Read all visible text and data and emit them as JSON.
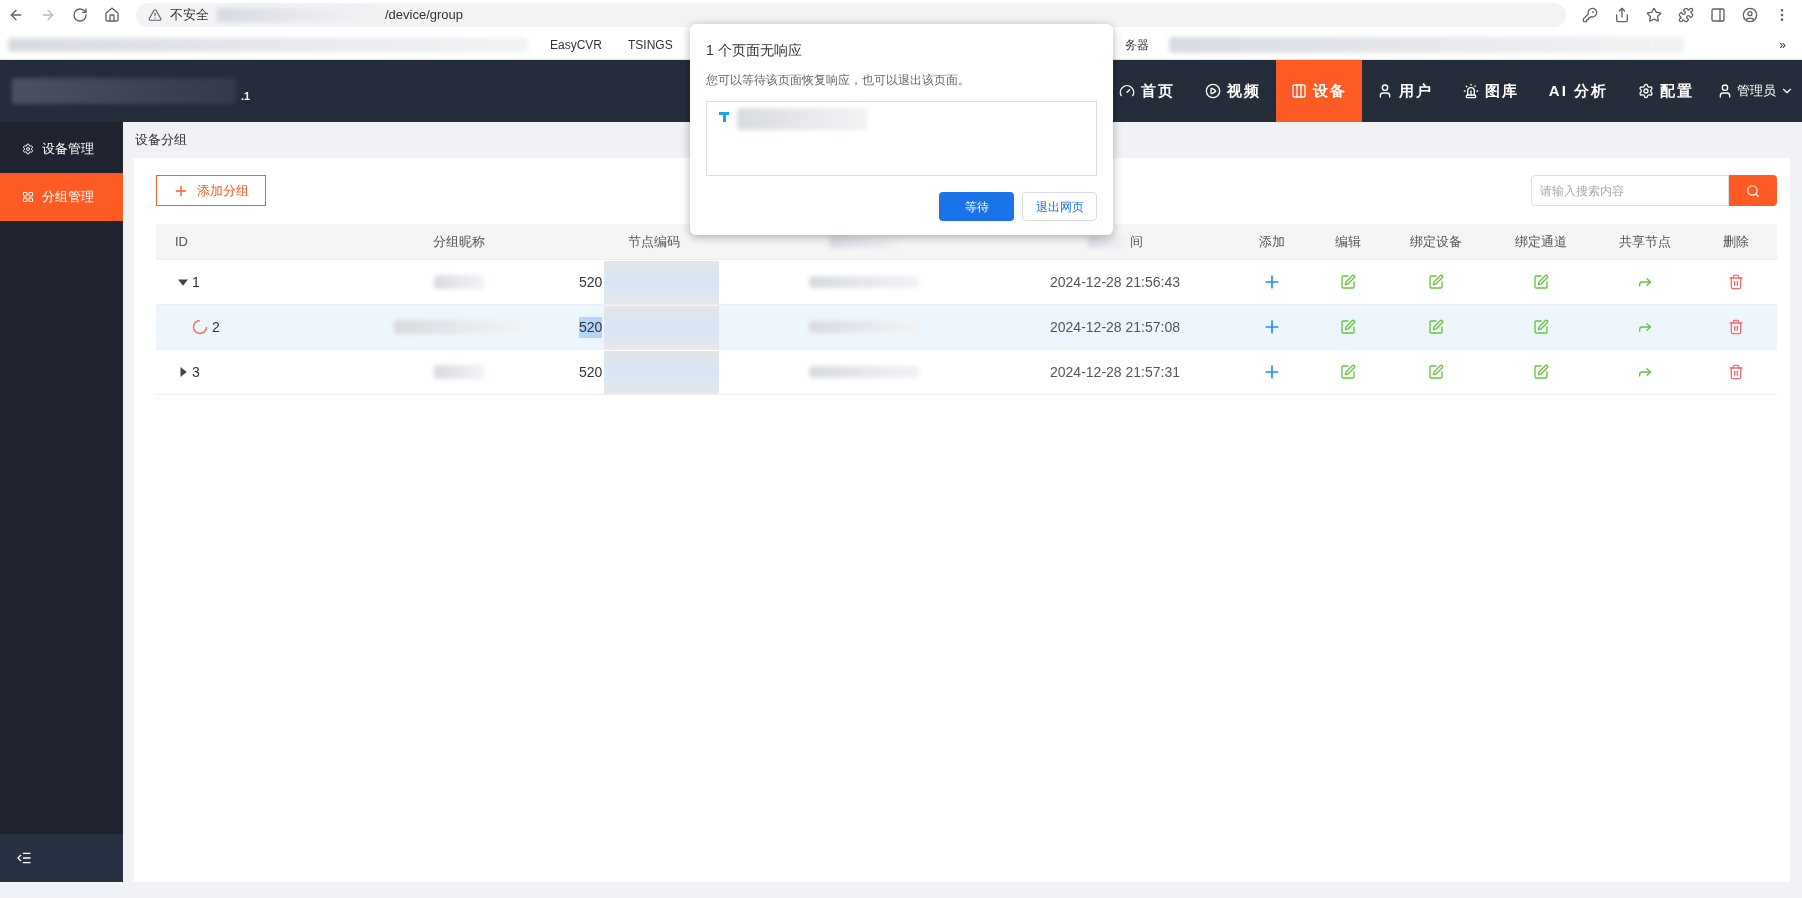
{
  "browser": {
    "security": "不安全",
    "url": "/device/group",
    "bookmarks": [
      {
        "label": "EasyCVR"
      },
      {
        "label": "TSINGS"
      }
    ],
    "bookmark_after_dialog": "务器",
    "more": "»"
  },
  "header": {
    "title_suffix": ".1",
    "nav": [
      {
        "label": "首页",
        "selected": false
      },
      {
        "label": "视频",
        "selected": false
      },
      {
        "label": "设备",
        "selected": true
      },
      {
        "label": "用户",
        "selected": false
      },
      {
        "label": "图库",
        "selected": false
      },
      {
        "label": "AI 分析",
        "selected": false
      },
      {
        "label": "配置",
        "selected": false
      }
    ],
    "user": "管理员"
  },
  "sidebar": {
    "items": [
      {
        "label": "设备管理",
        "selected": false
      },
      {
        "label": "分组管理",
        "selected": true
      }
    ]
  },
  "breadcrumb": "设备分组",
  "add_button": "添加分组",
  "search": {
    "placeholder": "请输入搜索内容"
  },
  "table": {
    "columns": [
      "ID",
      "分组昵称",
      "节点编码",
      "间",
      "添加",
      "编辑",
      "绑定设备",
      "绑定通道",
      "共享节点",
      "删除"
    ],
    "rows": [
      {
        "id": "1",
        "kind": "branch",
        "expanded": true,
        "loading": false,
        "selected": false,
        "code": "520",
        "time": "2024-12-28 21:56:43"
      },
      {
        "id": "2",
        "kind": "leaf",
        "loading": true,
        "selected": true,
        "code": "520",
        "time": "2024-12-28 21:57:08"
      },
      {
        "id": "3",
        "kind": "branch",
        "expanded": false,
        "loading": false,
        "selected": false,
        "code": "520",
        "time": "2024-12-28 21:57:31"
      }
    ]
  },
  "dialog": {
    "title": "1 个页面无响应",
    "message": "您可以等待该页面恢复响应，也可以退出该页面。",
    "buttons": [
      {
        "label": "等待",
        "primary": true
      },
      {
        "label": "退出网页",
        "primary": false
      }
    ]
  }
}
